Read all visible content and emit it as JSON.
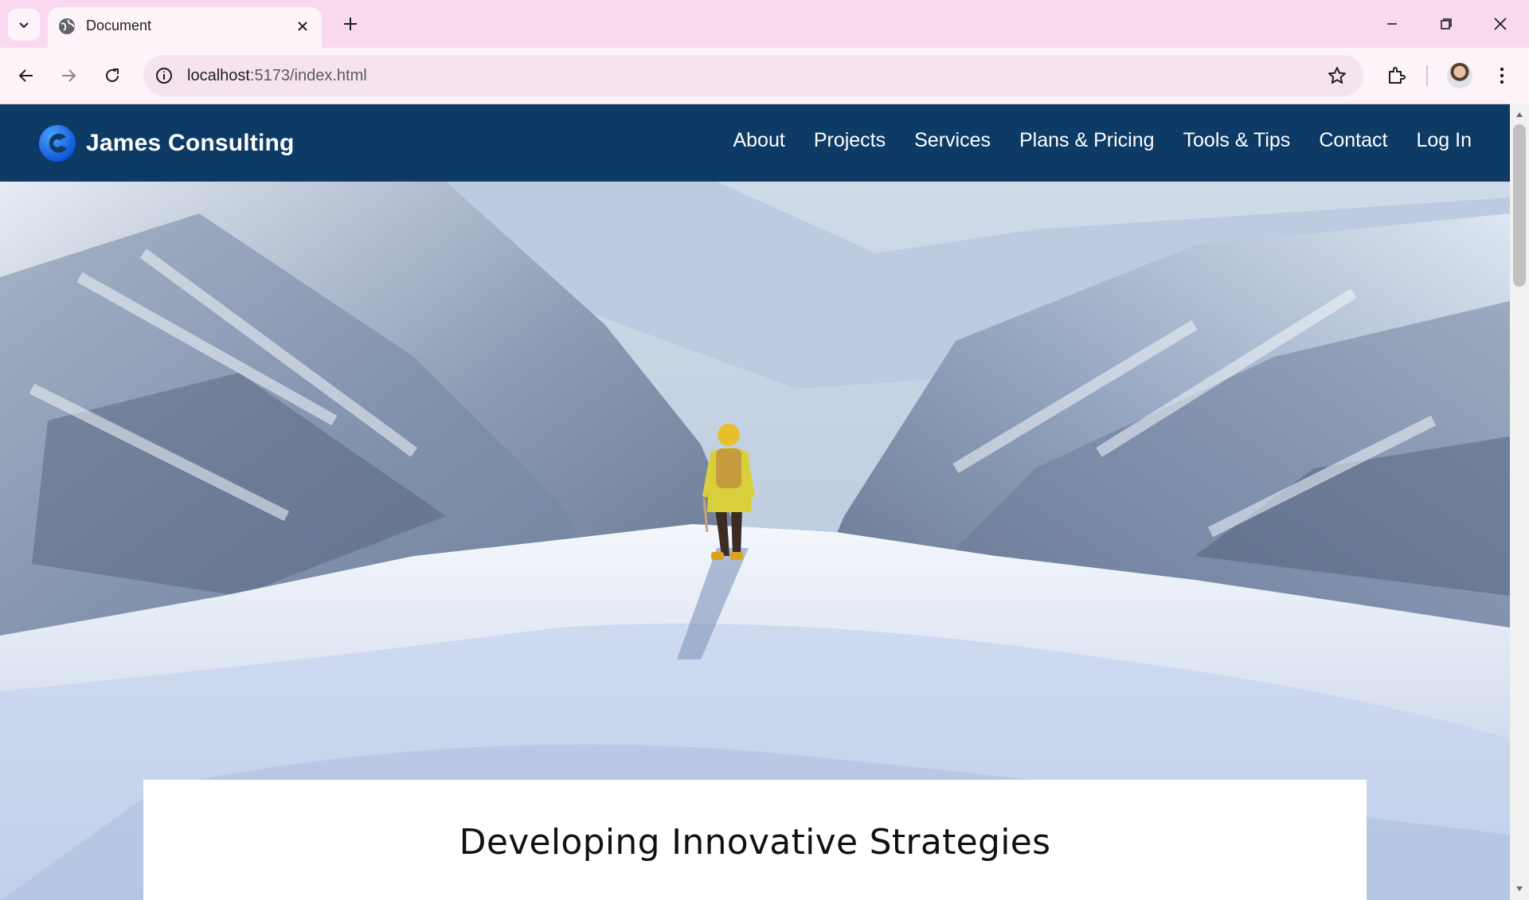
{
  "browser": {
    "tab_title": "Document",
    "url_host": "localhost",
    "url_path": ":5173/index.html",
    "icons": [
      "tab-search-icon",
      "globe-icon",
      "close-icon",
      "plus-icon",
      "minimize-icon",
      "restore-icon",
      "window-close-icon",
      "back-icon",
      "forward-icon",
      "reload-icon",
      "info-icon",
      "star-icon",
      "extensions-icon",
      "menu-icon"
    ]
  },
  "header": {
    "brand_name": "James Consulting",
    "nav": [
      "About",
      "Projects",
      "Services",
      "Plans & Pricing",
      "Tools & Tips",
      "Contact",
      "Log In"
    ]
  },
  "hero": {
    "image": "mountaineer-on-snowy-summit"
  },
  "content": {
    "heading": "Developing Innovative Strategies"
  },
  "colors": {
    "header_bg": "#0d3b66",
    "chrome_bg": "#f9d9ee",
    "toolbar_bg": "#fdf4fa"
  }
}
